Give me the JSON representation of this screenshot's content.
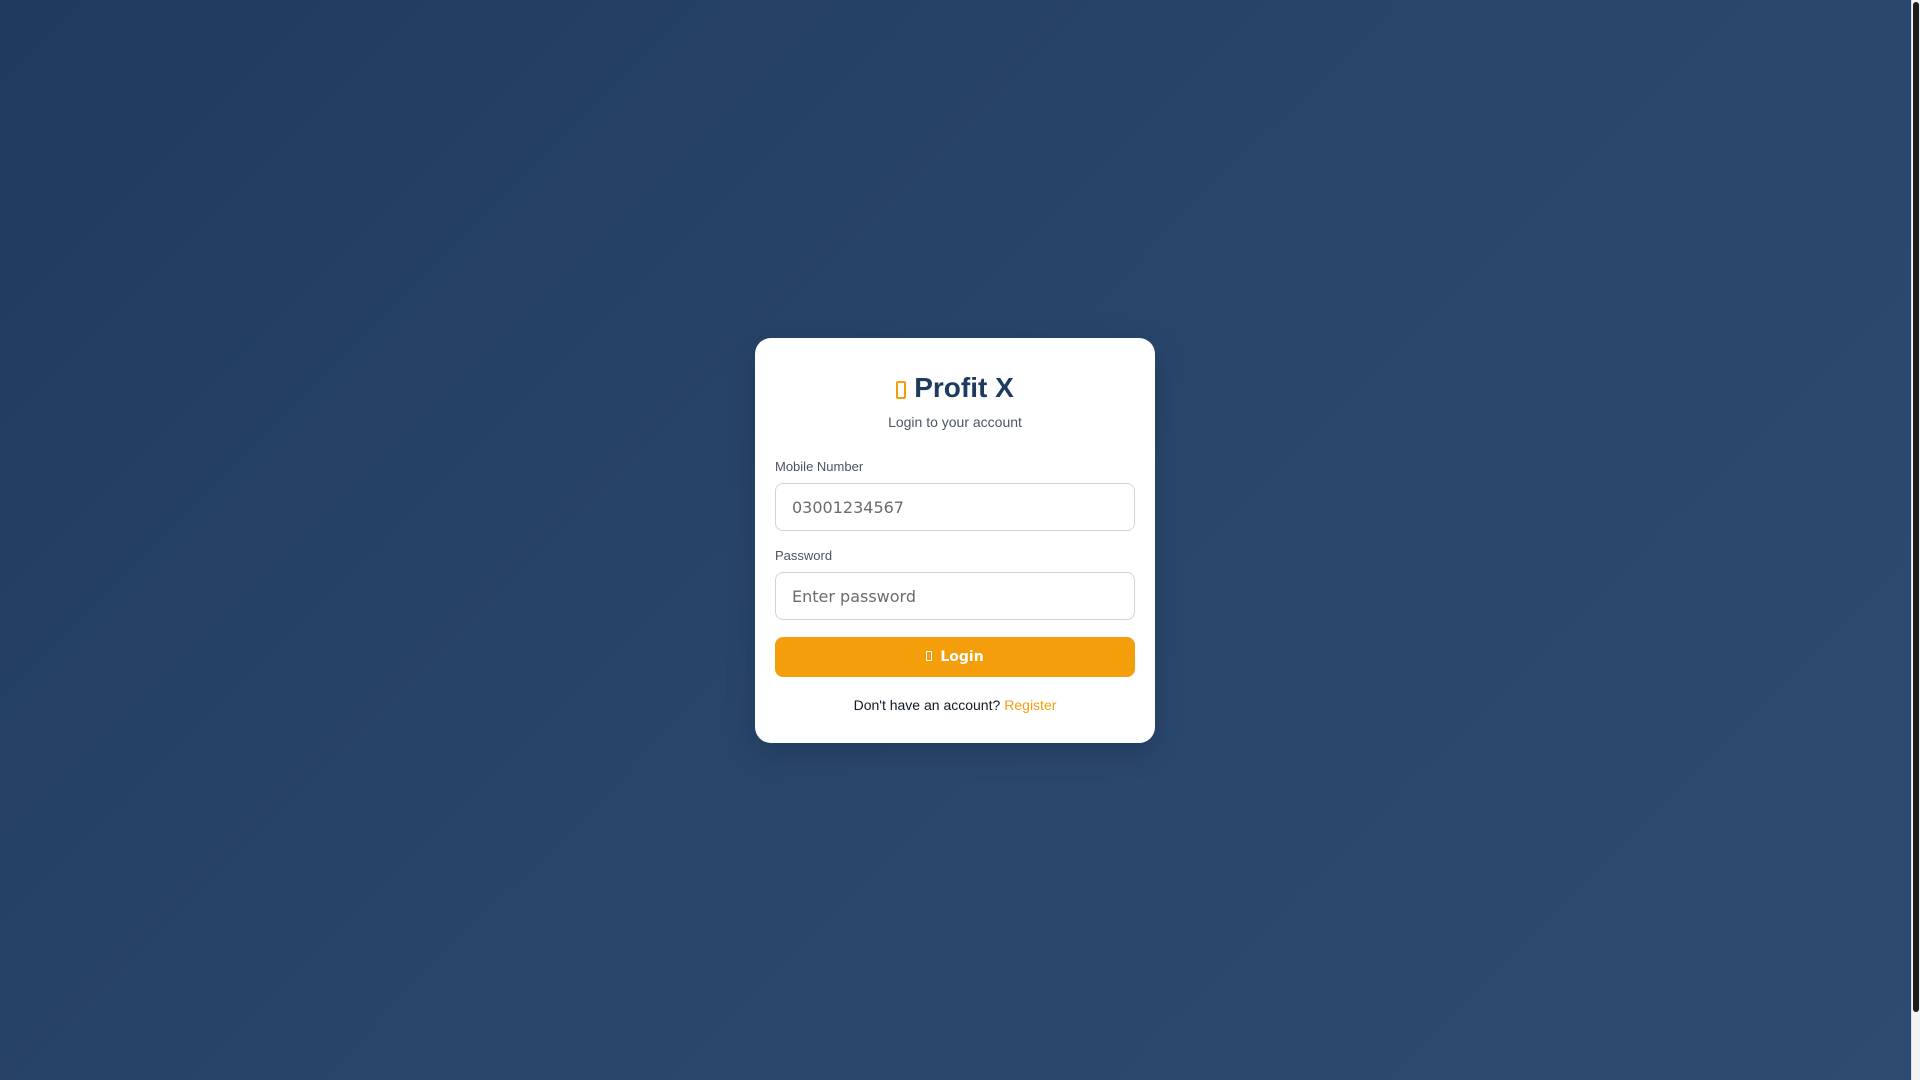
{
  "login": {
    "brand_title": "Profit X",
    "brand_icon": "brand-icon",
    "subtitle": "Login to your account",
    "mobile_label": "Mobile Number",
    "mobile_placeholder": "03001234567",
    "password_label": "Password",
    "password_placeholder": "Enter password",
    "login_button_label": "Login",
    "login_button_icon": "login-icon",
    "register_prompt": "Don't have an account?",
    "register_link": "Register"
  },
  "colors": {
    "accent": "#f59e0b",
    "brand_text": "#1e3a5f",
    "background_start": "#1f3a5f",
    "background_end": "#2d4b70"
  }
}
